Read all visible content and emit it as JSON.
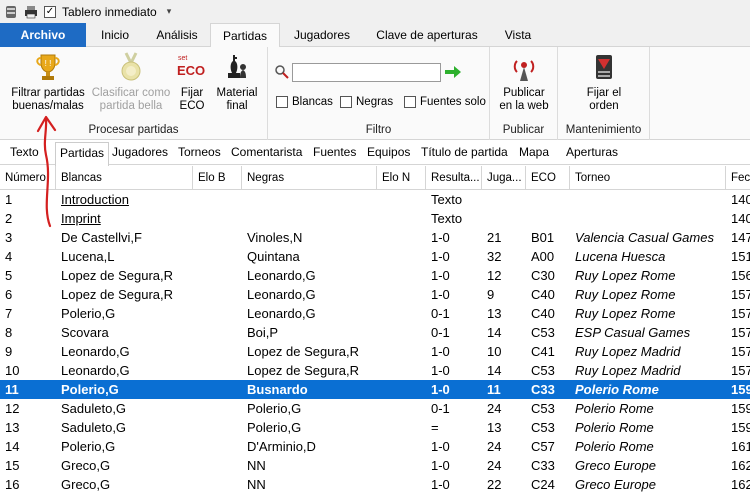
{
  "qat": {
    "title": "Tablero inmediato",
    "checked": "✓"
  },
  "ribbon": {
    "tabs": [
      "Archivo",
      "Inicio",
      "Análisis",
      "Partidas",
      "Jugadores",
      "Clave de aperturas",
      "Vista"
    ],
    "active_tab": "Partidas",
    "groups": {
      "procesar": {
        "label": "Procesar partidas",
        "buttons": [
          {
            "label_l1": "Filtrar partidas",
            "label_l2": "buenas/malas",
            "enabled": true
          },
          {
            "label_l1": "Clasificar como",
            "label_l2": "partida bella",
            "enabled": false
          },
          {
            "label_l1": "Fijar",
            "label_l2": "ECO",
            "enabled": true,
            "icon_text": "ECO",
            "icon_sup": "set"
          },
          {
            "label_l1": "Material",
            "label_l2": "final",
            "enabled": true
          }
        ]
      },
      "filtro": {
        "label": "Filtro",
        "search_value": "",
        "checkboxes": [
          "Blancas",
          "Negras",
          "Fuentes solo"
        ]
      },
      "publicar": {
        "label": "Publicar",
        "button_l1": "Publicar",
        "button_l2": "en la web"
      },
      "mantenimiento": {
        "label": "Mantenimiento",
        "button_l1": "Fijar el",
        "button_l2": "orden"
      }
    }
  },
  "subtabs": [
    "Texto",
    "Partidas",
    "Jugadores",
    "Torneos",
    "Comentarista",
    "Fuentes",
    "Equipos",
    "Título de partida",
    "Mapa",
    "Aperturas"
  ],
  "active_subtab": "Partidas",
  "columns": [
    "Número",
    "Blancas",
    "Elo B",
    "Negras",
    "Elo N",
    "Resulta...",
    "Juga...",
    "ECO",
    "Torneo",
    "Fech"
  ],
  "rows": [
    [
      "1",
      "Introduction",
      "",
      "",
      "",
      "Texto",
      "",
      "",
      "",
      "140"
    ],
    [
      "2",
      "Imprint",
      "",
      "",
      "",
      "Texto",
      "",
      "",
      "",
      "140"
    ],
    [
      "3",
      "De Castellvi,F",
      "",
      "Vinoles,N",
      "",
      "1-0",
      "21",
      "B01",
      "Valencia Casual Games",
      "147"
    ],
    [
      "4",
      "Lucena,L",
      "",
      "Quintana",
      "",
      "1-0",
      "32",
      "A00",
      "Lucena Huesca",
      "151"
    ],
    [
      "5",
      "Lopez de Segura,R",
      "",
      "Leonardo,G",
      "",
      "1-0",
      "12",
      "C30",
      "Ruy Lopez Rome",
      "156"
    ],
    [
      "6",
      "Lopez de Segura,R",
      "",
      "Leonardo,G",
      "",
      "1-0",
      "9",
      "C40",
      "Ruy Lopez Rome",
      "157"
    ],
    [
      "7",
      "Polerio,G",
      "",
      "Leonardo,G",
      "",
      "0-1",
      "13",
      "C40",
      "Ruy Lopez Rome",
      "157"
    ],
    [
      "8",
      "Scovara",
      "",
      "Boi,P",
      "",
      "0-1",
      "14",
      "C53",
      "ESP Casual Games",
      "157"
    ],
    [
      "9",
      "Leonardo,G",
      "",
      "Lopez de Segura,R",
      "",
      "1-0",
      "10",
      "C41",
      "Ruy Lopez Madrid",
      "157"
    ],
    [
      "10",
      "Leonardo,G",
      "",
      "Lopez de Segura,R",
      "",
      "1-0",
      "14",
      "C53",
      "Ruy Lopez Madrid",
      "157"
    ],
    [
      "11",
      "Polerio,G",
      "",
      "Busnardo",
      "",
      "1-0",
      "11",
      "C33",
      "Polerio Rome",
      "159"
    ],
    [
      "12",
      "Saduleto,G",
      "",
      "Polerio,G",
      "",
      "0-1",
      "24",
      "C53",
      "Polerio Rome",
      "159"
    ],
    [
      "13",
      "Saduleto,G",
      "",
      "Polerio,G",
      "",
      "=",
      "13",
      "C53",
      "Polerio Rome",
      "159"
    ],
    [
      "14",
      "Polerio,G",
      "",
      "D'Arminio,D",
      "",
      "1-0",
      "24",
      "C57",
      "Polerio Rome",
      "161"
    ],
    [
      "15",
      "Greco,G",
      "",
      "NN",
      "",
      "1-0",
      "24",
      "C33",
      "Greco Europe",
      "162"
    ],
    [
      "16",
      "Greco,G",
      "",
      "NN",
      "",
      "1-0",
      "22",
      "C24",
      "Greco Europe",
      "162"
    ]
  ],
  "selected_row": 10,
  "colors": {
    "accent": "#1e6bc4",
    "selection": "#0a6fd3",
    "annotation": "#d42020"
  }
}
